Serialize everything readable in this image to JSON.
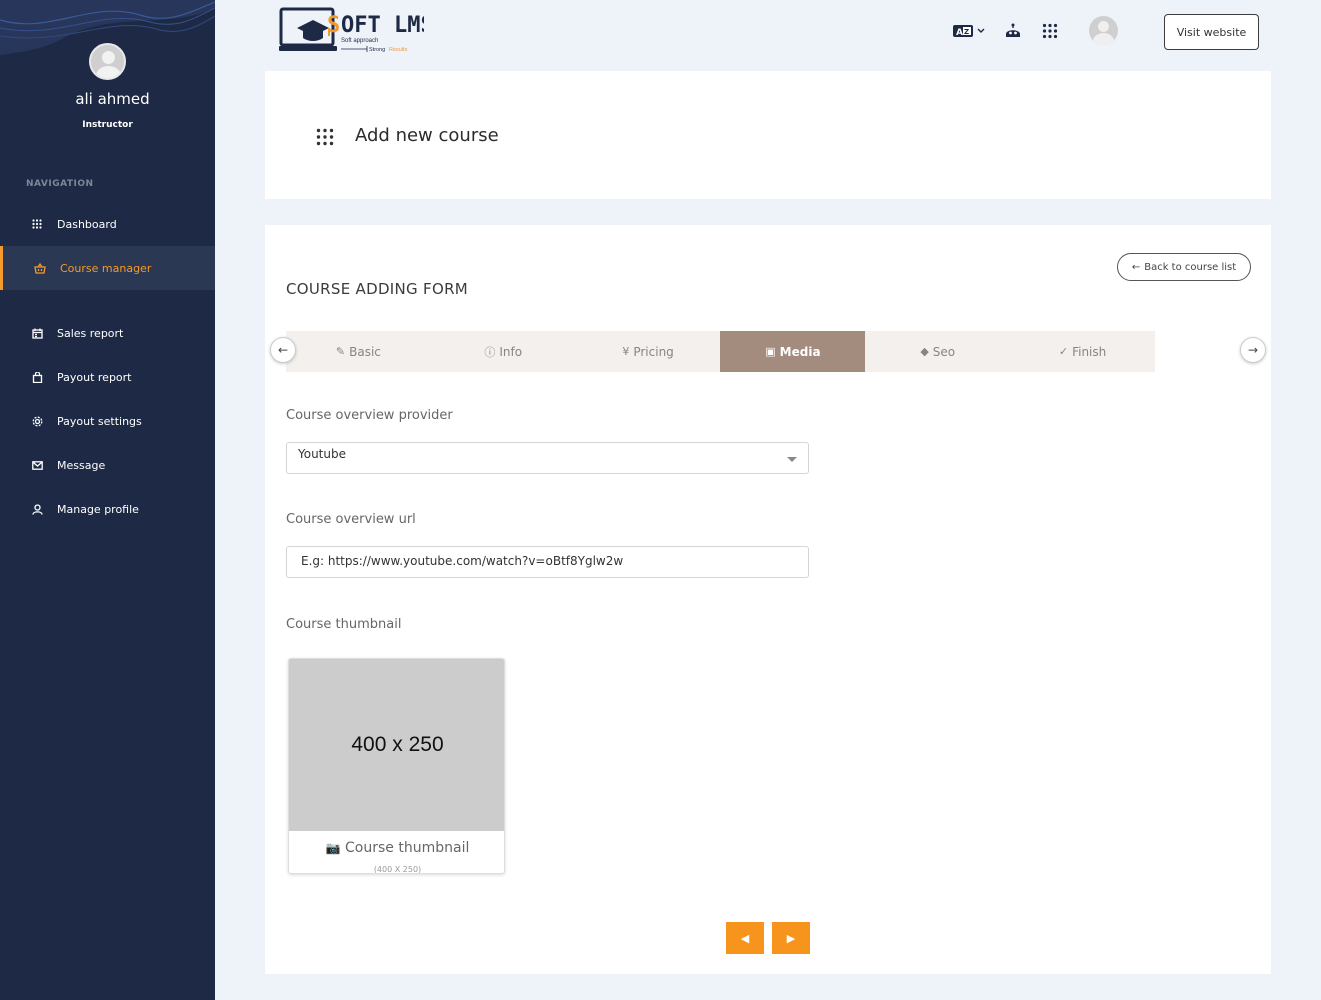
{
  "sidebar": {
    "user_name": "ali ahmed",
    "user_role": "Instructor",
    "nav_title": "NAVIGATION",
    "items": [
      {
        "label": "Dashboard",
        "icon": "grid-icon"
      },
      {
        "label": "Course manager",
        "icon": "basket-icon",
        "active": true
      },
      {
        "label": "Sales report",
        "icon": "calendar-icon"
      },
      {
        "label": "Payout report",
        "icon": "bag-icon"
      },
      {
        "label": "Payout settings",
        "icon": "gear-icon"
      },
      {
        "label": "Message",
        "icon": "mail-icon"
      },
      {
        "label": "Manage profile",
        "icon": "user-icon"
      }
    ]
  },
  "header": {
    "logo_text": "SOFT LMS",
    "logo_tagline_1": "Soft approach",
    "logo_tagline_2": "Strong Results",
    "visit_label": "Visit website"
  },
  "page": {
    "title": "Add new course"
  },
  "form": {
    "title": "COURSE ADDING FORM",
    "back_label": "Back to course list",
    "tabs": [
      {
        "label": "Basic",
        "icon": "pen-icon"
      },
      {
        "label": "Info",
        "icon": "info-icon"
      },
      {
        "label": "Pricing",
        "icon": "yen-icon"
      },
      {
        "label": "Media",
        "icon": "media-icon",
        "active": true
      },
      {
        "label": "Seo",
        "icon": "tag-icon"
      },
      {
        "label": "Finish",
        "icon": "check-circle-icon"
      }
    ],
    "provider_label": "Course overview provider",
    "provider_value": "Youtube",
    "url_label": "Course overview url",
    "url_placeholder": "E.g: https://www.youtube.com/watch?v=oBtf8Yglw2w",
    "thumb_label": "Course thumbnail",
    "thumb_placeholder": "400 x 250",
    "thumb_caption": "Course thumbnail",
    "thumb_sub": "(400 X 250)"
  },
  "colors": {
    "sidebar_bg": "#1e2a45",
    "accent": "#f39a2c",
    "active_tab": "#a38b7d",
    "button": "#f7941d"
  }
}
